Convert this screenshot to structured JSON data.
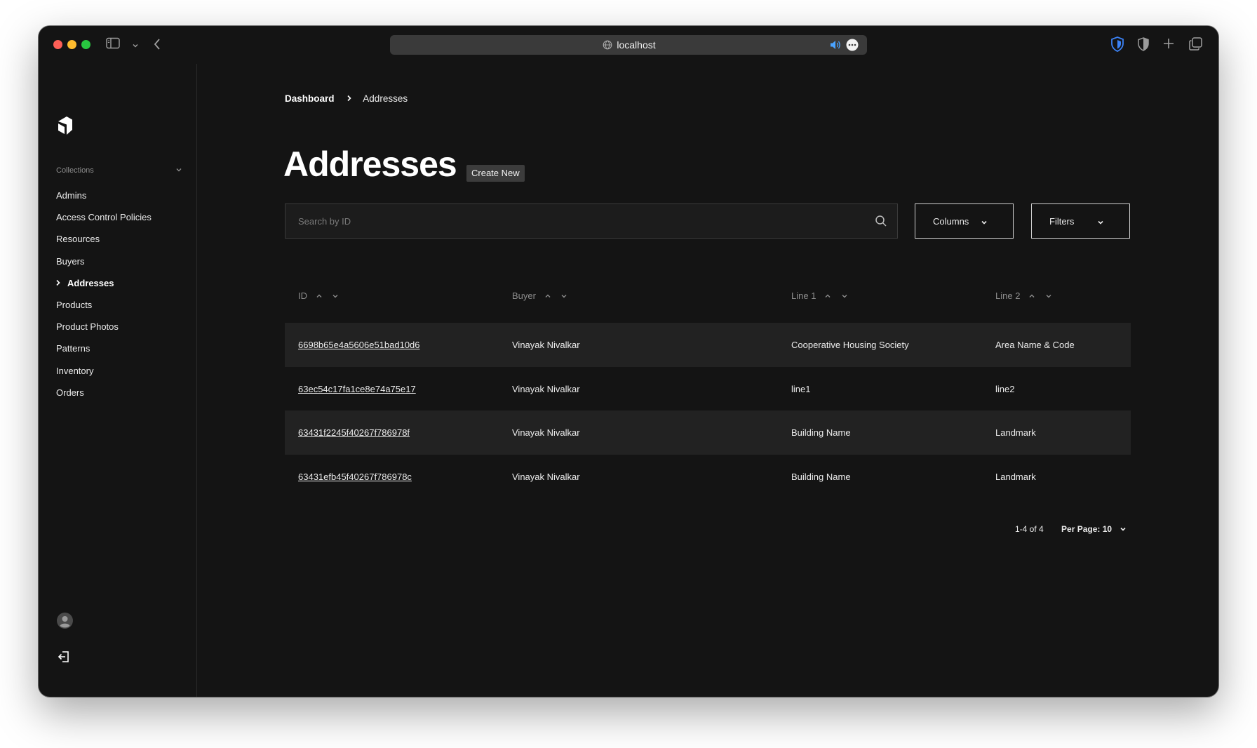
{
  "browser": {
    "url": "localhost"
  },
  "sidebar": {
    "section_label": "Collections",
    "items": [
      {
        "label": "Admins"
      },
      {
        "label": "Access Control Policies"
      },
      {
        "label": "Resources"
      },
      {
        "label": "Buyers"
      },
      {
        "label": "Addresses",
        "active": true
      },
      {
        "label": "Products"
      },
      {
        "label": "Product Photos"
      },
      {
        "label": "Patterns"
      },
      {
        "label": "Inventory"
      },
      {
        "label": "Orders"
      }
    ]
  },
  "breadcrumb": {
    "parent": "Dashboard",
    "current": "Addresses"
  },
  "page": {
    "title": "Addresses",
    "create_label": "Create New"
  },
  "search": {
    "placeholder": "Search by ID"
  },
  "controls": {
    "columns_label": "Columns",
    "filters_label": "Filters"
  },
  "table": {
    "columns": [
      "ID",
      "Buyer",
      "Line 1",
      "Line 2"
    ],
    "rows": [
      {
        "id": "6698b65e4a5606e51bad10d6",
        "buyer": "Vinayak Nivalkar",
        "line1": "Cooperative Housing Society",
        "line2": "Area Name & Code"
      },
      {
        "id": "63ec54c17fa1ce8e74a75e17",
        "buyer": "Vinayak Nivalkar",
        "line1": "line1",
        "line2": "line2"
      },
      {
        "id": "63431f2245f40267f786978f",
        "buyer": "Vinayak Nivalkar",
        "line1": "Building Name",
        "line2": "Landmark"
      },
      {
        "id": "63431efb45f40267f786978c",
        "buyer": "Vinayak Nivalkar",
        "line1": "Building Name",
        "line2": "Landmark"
      }
    ]
  },
  "pagination": {
    "range": "1-4 of 4",
    "per_page": "Per Page: 10"
  }
}
